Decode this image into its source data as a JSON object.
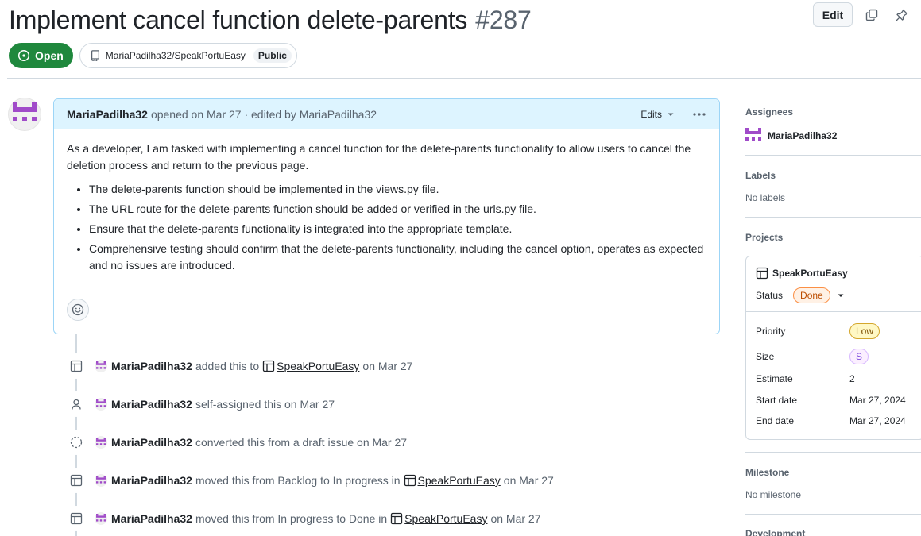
{
  "issue": {
    "title": "Implement cancel function delete-parents",
    "number": "#287",
    "edit_label": "Edit",
    "state": "Open",
    "repo": "MariaPadilha32/SpeakPortuEasy",
    "visibility": "Public"
  },
  "comment": {
    "author": "MariaPadilha32",
    "meta": "opened on Mar 27 · edited by MariaPadilha32",
    "edits_label": "Edits",
    "paragraph": "As a developer, I am tasked with implementing a cancel function for the delete-parents functionality to allow users to cancel the deletion process and return to the previous page.",
    "bullets": [
      "The delete-parents function should be implemented in the views.py file.",
      "The URL route for the delete-parents function should be added or verified in the urls.py file.",
      "Ensure that the delete-parents functionality is integrated into the appropriate template.",
      "Comprehensive testing should confirm that the delete-parents functionality, including the cancel option, operates as expected and no issues are introduced."
    ]
  },
  "timeline": [
    {
      "icon": "table-icon",
      "author": "MariaPadilha32",
      "pre": "added this to",
      "link": "SpeakPortuEasy",
      "post": "on Mar 27"
    },
    {
      "icon": "person-icon",
      "author": "MariaPadilha32",
      "pre": "self-assigned this on Mar 27",
      "link": "",
      "post": ""
    },
    {
      "icon": "dashed-circle-icon",
      "author": "MariaPadilha32",
      "pre": "converted this from a draft issue on Mar 27",
      "link": "",
      "post": ""
    },
    {
      "icon": "table-icon",
      "author": "MariaPadilha32",
      "pre": "moved this from Backlog to In progress in",
      "link": "SpeakPortuEasy",
      "post": "on Mar 27"
    },
    {
      "icon": "table-icon",
      "author": "MariaPadilha32",
      "pre": "moved this from In progress to Done in",
      "link": "SpeakPortuEasy",
      "post": "on Mar 27"
    }
  ],
  "sidebar": {
    "assignees_title": "Assignees",
    "assignee": "MariaPadilha32",
    "labels_title": "Labels",
    "labels_value": "No labels",
    "projects_title": "Projects",
    "project": {
      "name": "SpeakPortuEasy",
      "status_label": "Status",
      "status_value": "Done",
      "fields": [
        {
          "key": "Priority",
          "value": "Low"
        },
        {
          "key": "Size",
          "value": "S"
        },
        {
          "key": "Estimate",
          "value": "2"
        },
        {
          "key": "Start date",
          "value": "Mar 27, 2024"
        },
        {
          "key": "End date",
          "value": "Mar 27, 2024"
        }
      ]
    },
    "milestone_title": "Milestone",
    "milestone_value": "No milestone",
    "development_title": "Development"
  }
}
